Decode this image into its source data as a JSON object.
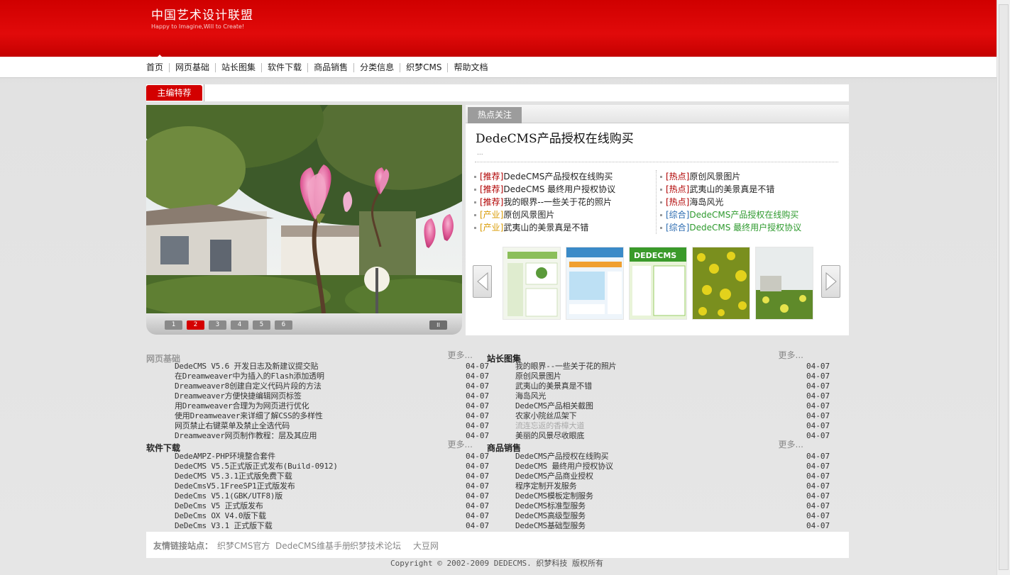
{
  "logo": {
    "title": "中国艺术设计联盟",
    "slogan": "Happy to Imagine,Will to Create!"
  },
  "nav": [
    "首页",
    "网页基础",
    "站长图集",
    "软件下载",
    "商品销售",
    "分类信息",
    "织梦CMS",
    "帮助文档"
  ],
  "recommend": {
    "label": "主编特荐"
  },
  "slider": {
    "pages": [
      "1",
      "2",
      "3",
      "4",
      "5",
      "6"
    ],
    "active": "2",
    "pause": "II"
  },
  "hot": {
    "tab": "热点关注",
    "headline": "DedeCMS产品授权在线购买",
    "desc": "...",
    "left": [
      {
        "tag": "[推荐]",
        "title": "DedeCMS产品授权在线购买"
      },
      {
        "tag": "[推荐]",
        "title": "DedeCMS 最终用户授权协议"
      },
      {
        "tag": "[推荐]",
        "title": "我的眼界--一些关于花的照片"
      },
      {
        "tag": "[产业]",
        "title": "原创风景图片"
      },
      {
        "tag": "[产业]",
        "title": "武夷山的美景真是不错"
      }
    ],
    "right": [
      {
        "tag": "[热点]",
        "title": "原创风景图片"
      },
      {
        "tag": "[热点]",
        "title": "武夷山的美景真是不错"
      },
      {
        "tag": "[热点]",
        "title": "海岛风光"
      },
      {
        "tag": "[综合]",
        "title": "DedeCMS产品授权在线购买"
      },
      {
        "tag": "[综合]",
        "title": "DedeCMS 最终用户授权协议"
      }
    ]
  },
  "sections": {
    "web": {
      "title": "网页基础",
      "more": "更多...",
      "items": [
        {
          "title": "DedeCMS V5.6 开发日志及新建议提交贴",
          "date": "04-07"
        },
        {
          "title": "在Dreamweaver中为插入的Flash添加透明",
          "date": "04-07"
        },
        {
          "title": "Dreamweaver8创建自定义代码片段的方法",
          "date": "04-07"
        },
        {
          "title": "Dreamweaver方便快捷编辑网页标签",
          "date": "04-07"
        },
        {
          "title": "用Dreamweaver合理为为网页进行优化",
          "date": "04-07"
        },
        {
          "title": "使用Dreamweaver来详细了解CSS的多样性",
          "date": "04-07"
        },
        {
          "title": "网页禁止右键菜单及禁止全选代码",
          "date": "04-07"
        },
        {
          "title": "Dreamweaver网页制作教程：层及其应用",
          "date": "04-07"
        }
      ]
    },
    "gallery": {
      "title": "站长图集",
      "more": "更多...",
      "items": [
        {
          "title": "我的眼界--一些关于花的照片",
          "date": "04-07"
        },
        {
          "title": "原创风景图片",
          "date": "04-07"
        },
        {
          "title": "武夷山的美景真是不错",
          "date": "04-07"
        },
        {
          "title": "海岛风光",
          "date": "04-07"
        },
        {
          "title": "DedeCMS产品相关截图",
          "date": "04-07"
        },
        {
          "title": "农家小院丝瓜架下",
          "date": "04-07"
        },
        {
          "title": "流连忘返的香樟大道",
          "date": "04-07"
        },
        {
          "title": "美丽的风景尽收眼底",
          "date": "04-07"
        }
      ]
    },
    "software": {
      "title": "软件下载",
      "more": "更多...",
      "items": [
        {
          "title": "DedeAMPZ-PHP环境整合套件",
          "date": "04-07"
        },
        {
          "title": "DedeCMS V5.5正式版正式发布(Build-0912)",
          "date": "04-07"
        },
        {
          "title": "DedeCMS V5.3.1正式版免费下载",
          "date": "04-07"
        },
        {
          "title": "DedeCmsV5.1FreeSP1正式版发布",
          "date": "04-07"
        },
        {
          "title": "DedeCms V5.1(GBK/UTF8)版",
          "date": "04-07"
        },
        {
          "title": "DeDeCms V5 正式版发布",
          "date": "04-07"
        },
        {
          "title": "DeDeCms OX V4.0版下载",
          "date": "04-07"
        },
        {
          "title": "DeDeCms V3.1 正式版下载",
          "date": "04-07"
        }
      ]
    },
    "shop": {
      "title": "商品销售",
      "more": "更多...",
      "items": [
        {
          "title": "DedeCMS产品授权在线购买",
          "date": "04-07"
        },
        {
          "title": "DedeCMS 最终用户授权协议",
          "date": "04-07"
        },
        {
          "title": "DedeCMS产品商业授权",
          "date": "04-07"
        },
        {
          "title": "程序定制开发服务",
          "date": "04-07"
        },
        {
          "title": "DedeCMS模板定制服务",
          "date": "04-07"
        },
        {
          "title": "DedeCMS标准型服务",
          "date": "04-07"
        },
        {
          "title": "DedeCMS高级型服务",
          "date": "04-07"
        },
        {
          "title": "DedeCMS基础型服务",
          "date": "04-07"
        }
      ]
    }
  },
  "links": {
    "label": "友情链接站点：",
    "items": [
      "织梦CMS官方",
      "DedeCMS维基手册",
      "织梦技术论坛",
      "大豆网"
    ]
  },
  "copyright": "Copyright © 2002-2009 DEDECMS. 织梦科技 版权所有"
}
